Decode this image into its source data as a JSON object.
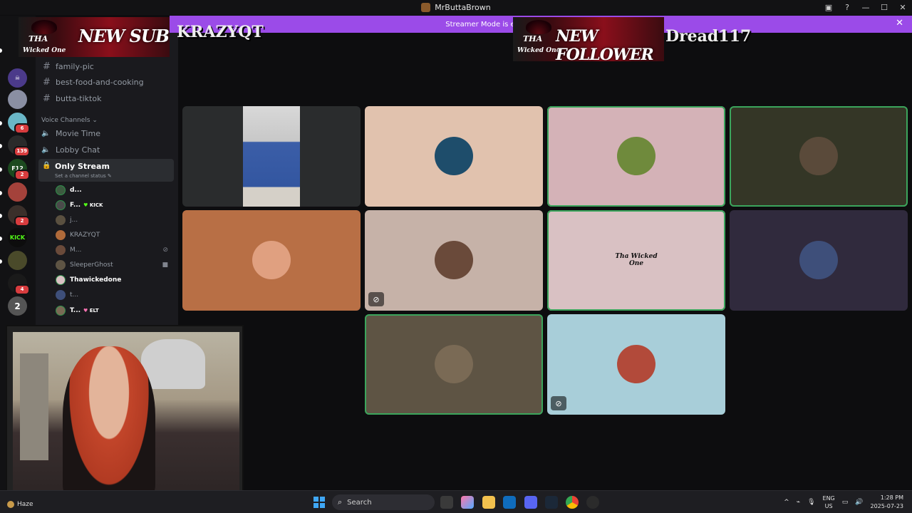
{
  "window": {
    "title": "MrButtaBrown"
  },
  "banner": {
    "text": "Streamer Mode is enabled. Usernames have been tru"
  },
  "servers": [
    {
      "badge": ""
    },
    {
      "badge": ""
    },
    {
      "badge": "6"
    },
    {
      "badge": "139"
    },
    {
      "badge": "2",
      "label": "F12"
    },
    {
      "badge": ""
    },
    {
      "badge": "2"
    },
    {
      "badge": "",
      "label": "KICK"
    },
    {
      "badge": ""
    },
    {
      "badge": "4"
    },
    {
      "badge": "",
      "label": "2"
    }
  ],
  "channels": {
    "text": [
      "family-pic",
      "best-food-and-cooking",
      "butta-tiktok"
    ],
    "voice_category": "Voice Channels",
    "voice": [
      "Movie Time",
      "Lobby Chat"
    ],
    "active_voice": {
      "name": "Only Stream",
      "status": "Set a channel status"
    },
    "members": [
      {
        "name": "d...",
        "tag": "",
        "highlight": true
      },
      {
        "name": "F...",
        "tag": "KICK",
        "highlight": true
      },
      {
        "name": "j...",
        "tag": "",
        "highlight": false
      },
      {
        "name": "KRAZYQT",
        "tag": "",
        "highlight": false
      },
      {
        "name": "M...",
        "tag": "",
        "highlight": false,
        "icon": "muted"
      },
      {
        "name": "SleeperGhost",
        "tag": "",
        "highlight": false,
        "icon": "camera"
      },
      {
        "name": "Thawickedone",
        "tag": "",
        "highlight": true
      },
      {
        "name": "t...",
        "tag": "",
        "highlight": false
      },
      {
        "name": "T...",
        "tag": "ELT",
        "highlight": true
      }
    ]
  },
  "overlays": {
    "sub": {
      "logo_top": "THA",
      "logo_bottom": "Wicked One",
      "label": "NEW SUB",
      "user": "KRAZYQT"
    },
    "follower": {
      "logo_top": "THA",
      "logo_bottom": "Wicked One",
      "label": "NEW FOLLOWER",
      "user": "Dread117"
    }
  },
  "tiles": [
    {
      "bg": "#2a2c2d",
      "speaking": false,
      "muted": false,
      "video": true
    },
    {
      "bg": "#e1c2ae",
      "speaking": false,
      "muted": false,
      "avatar": "#1e4d6b"
    },
    {
      "bg": "#d4b2b7",
      "speaking": true,
      "muted": false,
      "avatar": "#6f8a3c"
    },
    {
      "bg": "#343626",
      "speaking": true,
      "muted": false,
      "avatar": "#5a4a3a"
    },
    {
      "bg": "#b86f45",
      "speaking": false,
      "muted": false,
      "avatar": "#e0a080"
    },
    {
      "bg": "#c6b2a8",
      "speaking": false,
      "muted": true,
      "avatar": "#6a4a3a"
    },
    {
      "bg": "#d9c1c3",
      "speaking": true,
      "muted": false,
      "avatar": "#d9c1c3",
      "logo": "Tha Wicked One"
    },
    {
      "bg": "#302a3d",
      "speaking": false,
      "muted": false,
      "avatar": "#3e4f7a"
    },
    {
      "bg": "#5e5444",
      "speaking": true,
      "muted": false,
      "avatar": "#7a6a55"
    },
    {
      "bg": "#a8ced9",
      "speaking": false,
      "muted": true,
      "avatar": "#b24a3a"
    }
  ],
  "taskbar": {
    "weather": "Haze",
    "search_placeholder": "Search",
    "lang_top": "ENG",
    "lang_bottom": "US",
    "time": "1:28 PM",
    "date": "2025-07-23"
  },
  "colors": {
    "accent": "#9b4be8",
    "speaking": "#3ba55c",
    "badge": "#d83c3e"
  }
}
